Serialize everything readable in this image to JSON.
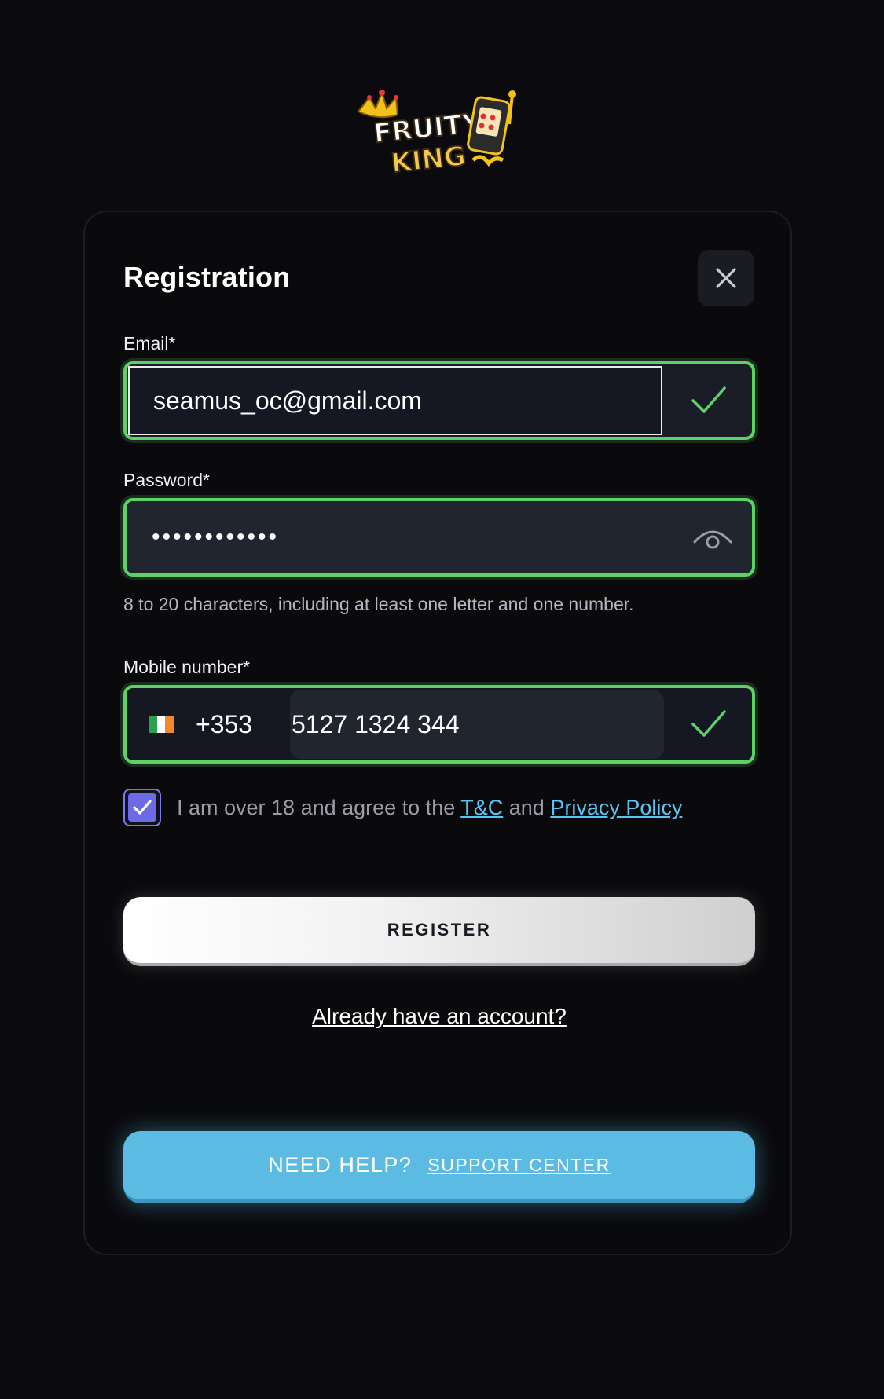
{
  "logo": {
    "line1": "FRUITY",
    "line2": "KING"
  },
  "modal": {
    "title": "Registration",
    "close_icon": "close-icon"
  },
  "email": {
    "label": "Email*",
    "value": "seamus_oc@gmail.com",
    "status_icon": "check-icon"
  },
  "password": {
    "label": "Password*",
    "value_masked": "••••••••••••",
    "toggle_icon": "eye-icon",
    "hint": "8 to 20 characters, including at least one letter and one number."
  },
  "mobile": {
    "label": "Mobile number*",
    "flag_icon": "ireland-flag-icon",
    "dial_code": "+353",
    "value": "5127 1324 344",
    "status_icon": "check-icon"
  },
  "terms": {
    "checked": true,
    "text_prefix": "I am over 18 and agree to the",
    "tc_link": "T&C",
    "text_and": "and",
    "privacy_link": "Privacy Policy"
  },
  "register_label": "REGISTER",
  "login_link": "Already have an account?",
  "help": {
    "text": "NEED HELP?",
    "link": "SUPPORT CENTER"
  },
  "colors": {
    "background": "#0b0b0f",
    "valid_border": "#5dd067",
    "link": "#5cc3f0",
    "checkbox": "#6d6ae8",
    "help_button": "#5bbbe2"
  }
}
